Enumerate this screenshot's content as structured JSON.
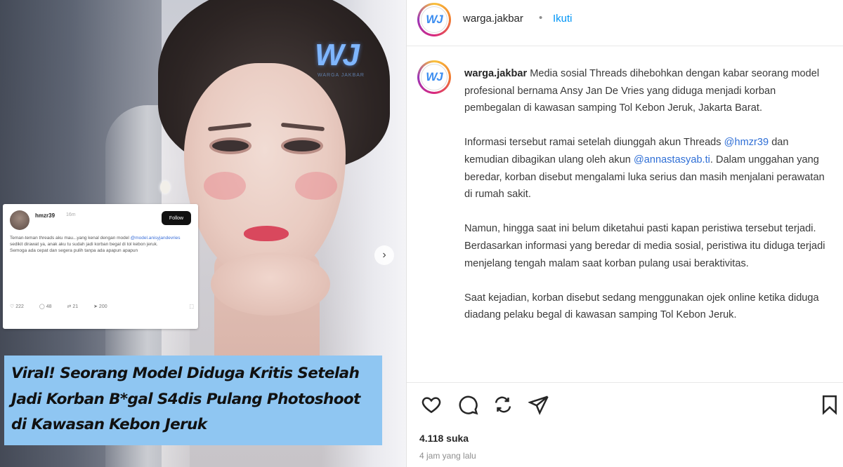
{
  "image": {
    "watermark_logo": "WJ",
    "watermark_sub": "WARGA JAKBAR",
    "next_icon": "chevron-right-icon",
    "embedded_post": {
      "username": "hmzr39",
      "time": "16m",
      "follow_label": "Follow",
      "text_before_mention": "Teman-teman threads aku mau...yang kenal dengan model ",
      "mention": "@model.anisyjandevries",
      "text_after_mention": " sedikit dirawat ya, anak aku tu sudah jadi korban begal di tol kebon jeruk.",
      "text_line2": "Semoga ada cepat dan segera pulih tanpa ada apapun apapun",
      "actions": [
        {
          "icon": "heart-icon",
          "count": "222"
        },
        {
          "icon": "comment-icon",
          "count": "48"
        },
        {
          "icon": "repost-icon",
          "count": "21"
        },
        {
          "icon": "send-icon",
          "count": "200"
        }
      ],
      "share_icon": "share-icon"
    },
    "caption_lines": [
      "Viral! Seorang Model Diduga Kritis Setelah",
      "Jadi Korban B*gal S4dis Pulang Photoshoot",
      "di Kawasan Kebon Jeruk"
    ]
  },
  "panel": {
    "header": {
      "avatar_text": "WJ",
      "username": "warga.jakbar",
      "separator": "•",
      "follow_label": "Ikuti"
    },
    "caption": {
      "username": "warga.jakbar",
      "paragraphs": [
        "Media sosial Threads dihebohkan dengan kabar seorang model profesional bernama Ansy Jan De Vries yang diduga menjadi korban pembegalan di kawasan samping Tol Kebon Jeruk, Jakarta Barat.",
        "Informasi tersebut ramai setelah diunggah akun Threads ",
        "Namun, hingga saat ini belum diketahui pasti kapan peristiwa tersebut terjadi. Berdasarkan informasi yang beredar di media sosial, peristiwa itu diduga terjadi menjelang tengah malam saat korban pulang usai beraktivitas.",
        "Saat kejadian, korban disebut sedang menggunakan ojek online ketika diduga diadang pelaku begal di kawasan samping Tol Kebon Jeruk."
      ],
      "mention_1": "@hmzr39",
      "p2_middle": " dan kemudian dibagikan ulang oleh akun ",
      "mention_2": "@annastasyab.ti",
      "p2_end": ". Dalam unggahan yang beredar, korban disebut mengalami luka serius dan masih menjalani perawatan di rumah sakit."
    },
    "actions": {
      "like": "heart-icon",
      "comment": "comment-icon",
      "share": "repost-icon",
      "send": "send-icon",
      "save": "bookmark-icon"
    },
    "likes": "4.118 suka",
    "time": "4 jam yang lalu"
  }
}
